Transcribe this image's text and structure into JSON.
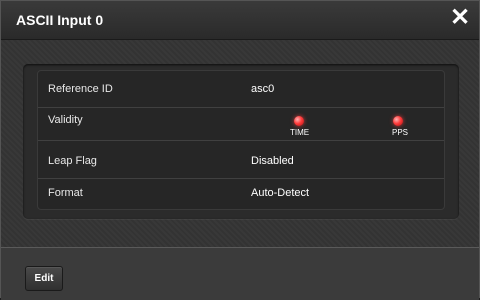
{
  "dialog": {
    "title": "ASCII Input 0",
    "close_icon": "close-icon"
  },
  "fields": [
    {
      "label": "Reference ID",
      "value": "asc0"
    },
    {
      "label": "Validity",
      "indicators": [
        {
          "label": "TIME",
          "status": "red",
          "color": "#ff3b3b"
        },
        {
          "label": "PPS",
          "status": "red",
          "color": "#ff3b3b"
        }
      ]
    },
    {
      "label": "Leap Flag",
      "value": "Disabled"
    },
    {
      "label": "Format",
      "value": "Auto-Detect"
    }
  ],
  "footer": {
    "edit_label": "Edit"
  }
}
